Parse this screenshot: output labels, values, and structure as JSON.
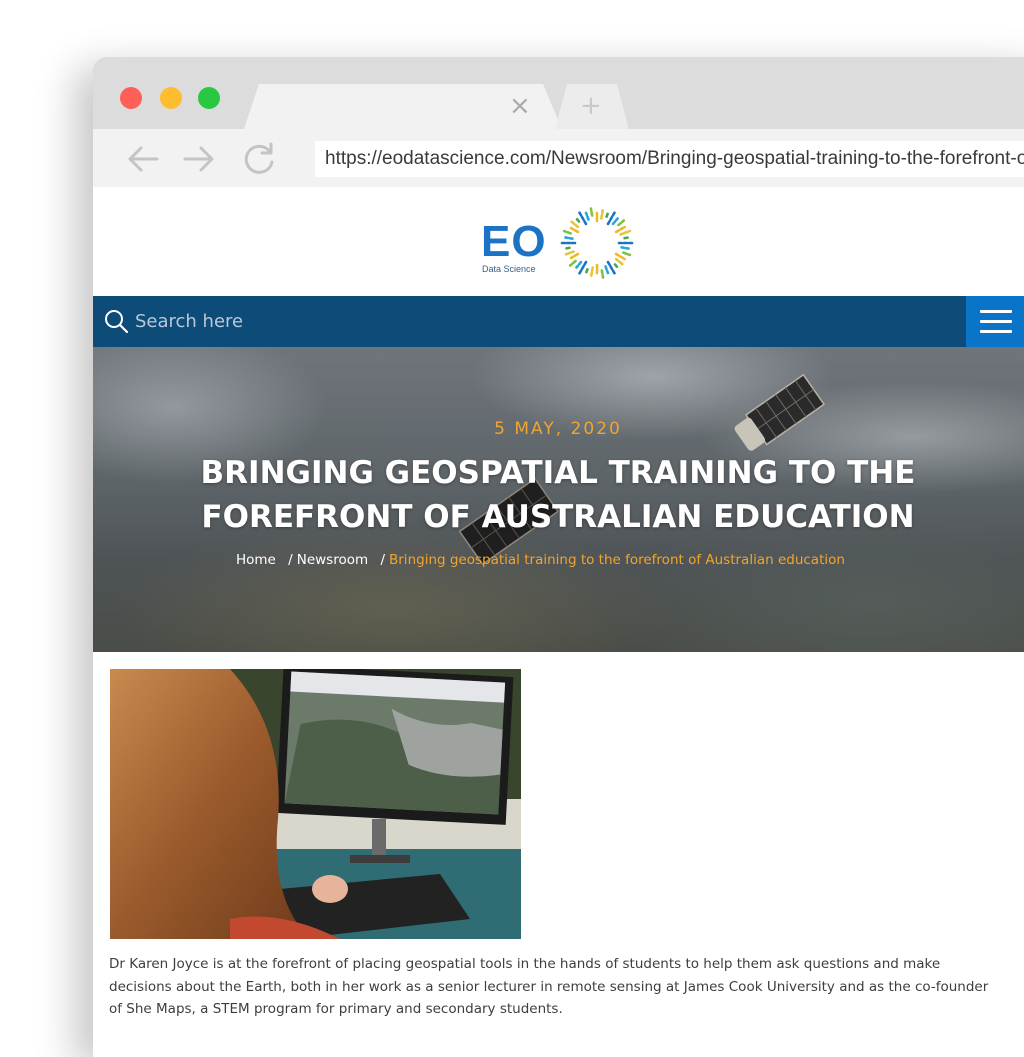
{
  "browser": {
    "tab": {
      "close_glyph": "×",
      "new_tab_glyph": "+"
    },
    "nav_icons": [
      "back-arrow-icon",
      "forward-arrow-icon",
      "reload-icon"
    ],
    "url": "https://eodatascience.com/Newsroom/Bringing-geospatial-training-to-the-forefront-of-australian-education"
  },
  "site": {
    "logo_text": "EO",
    "logo_subtitle": "Data Science",
    "search_placeholder": "Search here",
    "menu_icon": "hamburger-menu-icon",
    "brand_color": "#0d4b79",
    "accent_color": "#f0a431"
  },
  "hero": {
    "date": "5 MAY, 2020",
    "title": "BRINGING GEOSPATIAL TRAINING TO THE FOREFRONT OF AUSTRALIAN EDUCATION",
    "breadcrumb": {
      "home": "Home",
      "newsroom": "Newsroom",
      "separator": "/",
      "current": "Bringing geospatial training to the forefront of Australian education"
    }
  },
  "article": {
    "body": "Dr Karen Joyce is at the forefront of placing geospatial tools in the hands of students to help them ask questions and make decisions about the Earth, both in her work as a senior lecturer in remote sensing at James Cook University and as the co-founder of She Maps, a STEM program for primary and secondary students."
  }
}
